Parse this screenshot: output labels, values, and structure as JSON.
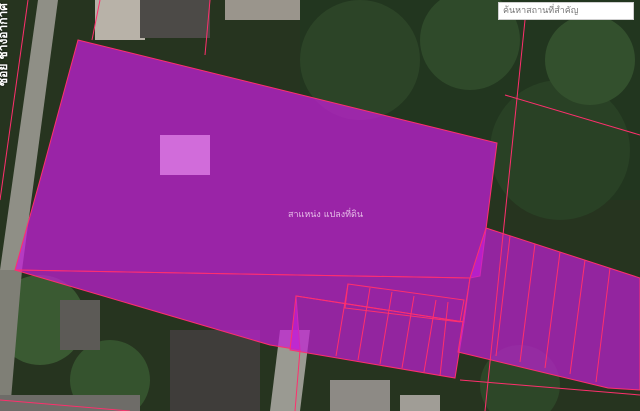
{
  "search": {
    "placeholder": "ค้นหาสถานที่สำคัญ"
  },
  "street_label": "ซอย ช่างอากาศ",
  "parcel_label": "สาแหน่ง แปลงที่ดิน",
  "colors": {
    "parcel_fill": "#c21fd6",
    "parcel_line": "#ff2f6d",
    "imagery_dark": "#1f2a1d",
    "trees": "#2e4a2a"
  }
}
